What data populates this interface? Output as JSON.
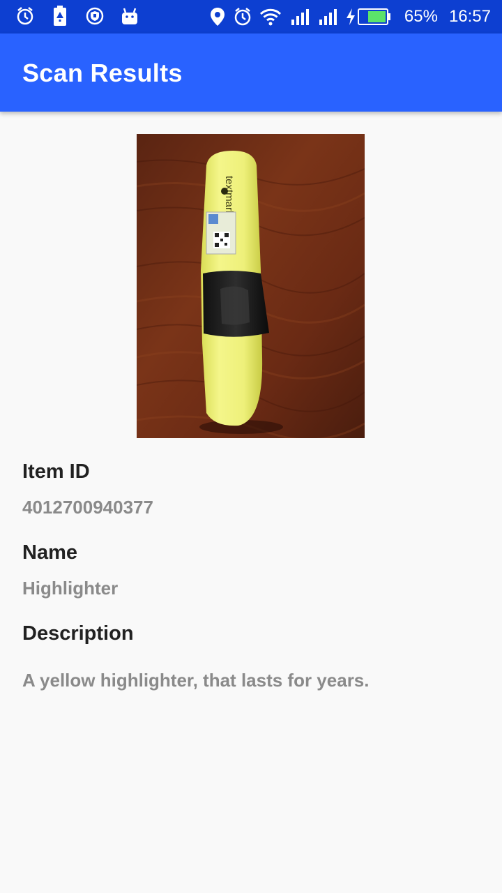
{
  "status_bar": {
    "battery_percent": "65%",
    "time": "16:57",
    "left_icons": [
      "alarm-icon",
      "battery-saver-icon",
      "shield-icon",
      "android-icon"
    ],
    "right_icons": [
      "location-icon",
      "alarm-icon",
      "wifi-icon",
      "signal-icon",
      "signal-icon",
      "charging-icon",
      "battery-icon"
    ],
    "color": "#0d3fd1"
  },
  "app_bar": {
    "title": "Scan Results",
    "color": "#2962ff"
  },
  "photo": {
    "subject": "highlighter-photo",
    "marker_text": "textmarker 490"
  },
  "fields": [
    {
      "label": "Item ID",
      "value": "4012700940377"
    },
    {
      "label": "Name",
      "value": "Highlighter"
    },
    {
      "label": "Description",
      "value": "A yellow highlighter, that lasts for years."
    }
  ]
}
